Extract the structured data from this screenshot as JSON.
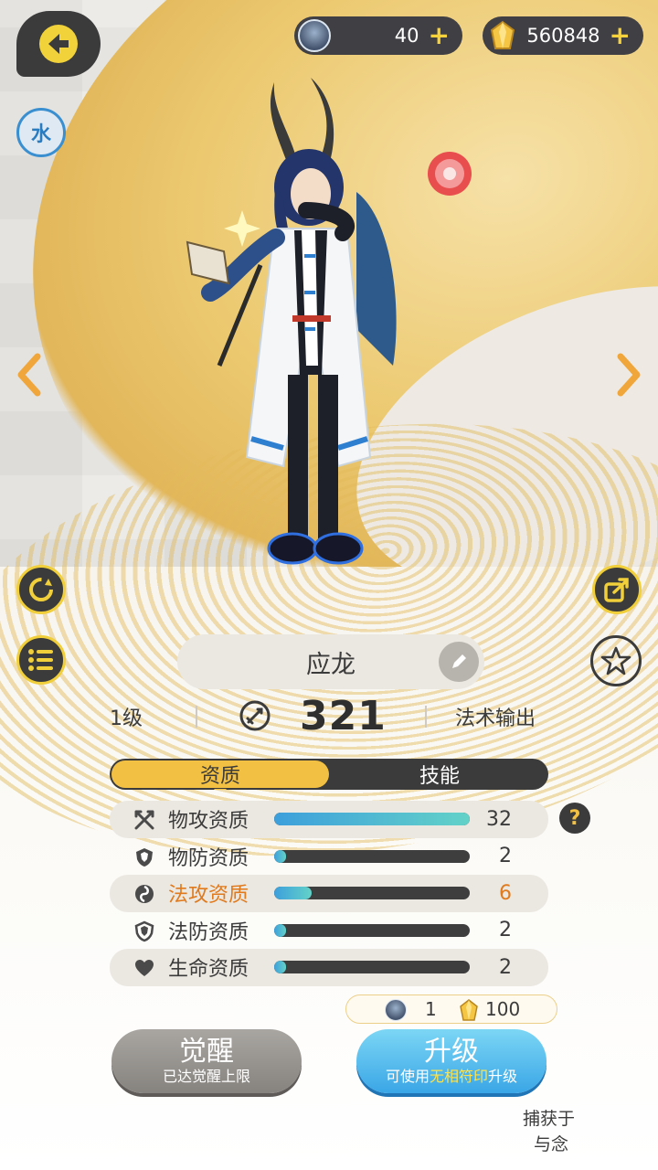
{
  "element": {
    "label": "水"
  },
  "currency": {
    "souls": {
      "value": "40",
      "plus": "+"
    },
    "gold": {
      "value": "560848",
      "plus": "+"
    }
  },
  "monster": {
    "name": "应龙",
    "level": "1级",
    "power": "321",
    "role": "法术输出"
  },
  "tabs": [
    {
      "label": "资质",
      "active": true
    },
    {
      "label": "技能",
      "active": false
    }
  ],
  "aptitudes": [
    {
      "label": "物攻资质",
      "value": "32",
      "fill": 1.0,
      "icon": "swords-icon"
    },
    {
      "label": "物防资质",
      "value": "2",
      "fill": 0.06,
      "icon": "shield-icon"
    },
    {
      "label": "法攻资质",
      "value": "6",
      "fill": 0.19,
      "icon": "magic-swirl-icon",
      "highlight": true
    },
    {
      "label": "法防资质",
      "value": "2",
      "fill": 0.06,
      "icon": "magic-shield-icon"
    },
    {
      "label": "生命资质",
      "value": "2",
      "fill": 0.06,
      "icon": "heart-icon"
    }
  ],
  "help": {
    "label": "?"
  },
  "cost": {
    "souls": "1",
    "gold": "100"
  },
  "buttons": {
    "awaken": {
      "main": "觉醒",
      "sub": "已达觉醒上限"
    },
    "upgrade": {
      "main": "升级",
      "sub_pre": "可使用",
      "sub_hl": "无相符印",
      "sub_post": "升级"
    }
  },
  "corner_text": {
    "line1": "捕获于",
    "line2": "与念"
  },
  "colors": {
    "accent": "#f2c043",
    "dark": "#3b3b3b",
    "highlight": "#e07a1c",
    "bar": "#3d9fdb"
  }
}
